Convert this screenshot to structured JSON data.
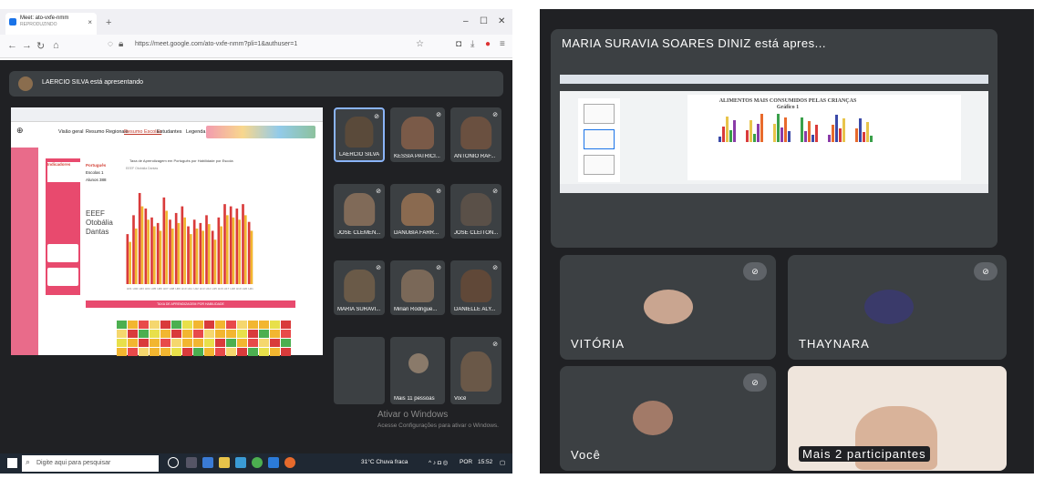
{
  "left": {
    "tab_title": "Meet: ato-vxfe-nmm",
    "tab_subtitle": "REPRODUZINDO",
    "url": "https://meet.google.com/ato-vxfe-nmm?pli=1&authuser=1",
    "presenter_text": "LAERCIO SILVA está apresentando",
    "dashboard": {
      "nav": [
        "Visão geral",
        "Resumo Regionais",
        "Resumo Escolas",
        "Estudantes",
        "Legenda"
      ],
      "active_nav": "Resumo Escolas",
      "indicator_label": "Indicadores",
      "subject": "Português",
      "subject_values": [
        {
          "label": "Escolas",
          "value": "1"
        },
        {
          "label": "Alunos",
          "value": "388"
        }
      ],
      "school_name": "EEEF Otobália Dantas",
      "chart_title": "Taxa de Aprendizagem em Português por Habilidade por Escola",
      "table_title": "TAXA DE APRENDIZAGEM POR HABILIDADE"
    },
    "participants": [
      {
        "name": "LAERCIO SILVA",
        "color": "#5a4a3a",
        "selected": true
      },
      {
        "name": "KESSIA PATRICI...",
        "color": "#7a5a48"
      },
      {
        "name": "ANTONIO RAF...",
        "color": "#6a5040"
      },
      {
        "name": "JOSE CLEMEN...",
        "color": "#806a58"
      },
      {
        "name": "DANUBIA FARR...",
        "color": "#8a6a50"
      },
      {
        "name": "JOSE CLEITON...",
        "color": "#5a5048"
      },
      {
        "name": "MARIA SURAVI...",
        "color": "#6a5a48"
      },
      {
        "name": "Mirian Rodrigue...",
        "color": "#7a6858"
      },
      {
        "name": "DANIELLE ALY...",
        "color": "#604838"
      },
      {
        "name": "Mais 11 pessoas",
        "color": "#3c4043"
      },
      {
        "name": "Você",
        "color": "#6a5848"
      }
    ],
    "watermark_title": "Ativar o Windows",
    "watermark_sub": "Acesse Configurações para ativar o Windows.",
    "taskbar": {
      "search_placeholder": "Digite aqui para pesquisar",
      "weather": "31°C  Chuva fraca",
      "lang": "POR",
      "time": "15:52"
    }
  },
  "right": {
    "presenting_title": "MARIA SURAVIA SOARES DINIZ está apres...",
    "slide_title": "ALIMENTOS MAIS CONSUMIDOS PELAS CRIANÇAS",
    "slide_subtitle": "Gráfico 1",
    "tiles": [
      {
        "name": "VITÓRIA",
        "muted": true
      },
      {
        "name": "THAYNARA",
        "muted": true
      },
      {
        "name": "Você",
        "muted": true
      },
      {
        "name": "Mais 2 participantes",
        "muted": false
      }
    ]
  },
  "chart_data": {
    "type": "bar",
    "categories": [
      "H01",
      "H02",
      "H03",
      "H04",
      "H05",
      "H06",
      "H07",
      "H08",
      "H09",
      "H10",
      "H11",
      "H12",
      "H13",
      "H14",
      "H15",
      "H16",
      "H17",
      "H18",
      "H19",
      "H20",
      "H21"
    ],
    "series": [
      {
        "name": "EEEF Otobália Dantas",
        "values": [
          45,
          62,
          82,
          68,
          60,
          55,
          78,
          58,
          64,
          70,
          52,
          58,
          55,
          62,
          48,
          60,
          72,
          70,
          68,
          72,
          56
        ]
      },
      {
        "values": [
          38,
          50,
          70,
          58,
          52,
          48,
          66,
          50,
          55,
          60,
          45,
          50,
          48,
          54,
          40,
          52,
          62,
          60,
          58,
          62,
          48
        ]
      }
    ],
    "colors": [
      "#d93b3b",
      "#f2b630"
    ]
  }
}
